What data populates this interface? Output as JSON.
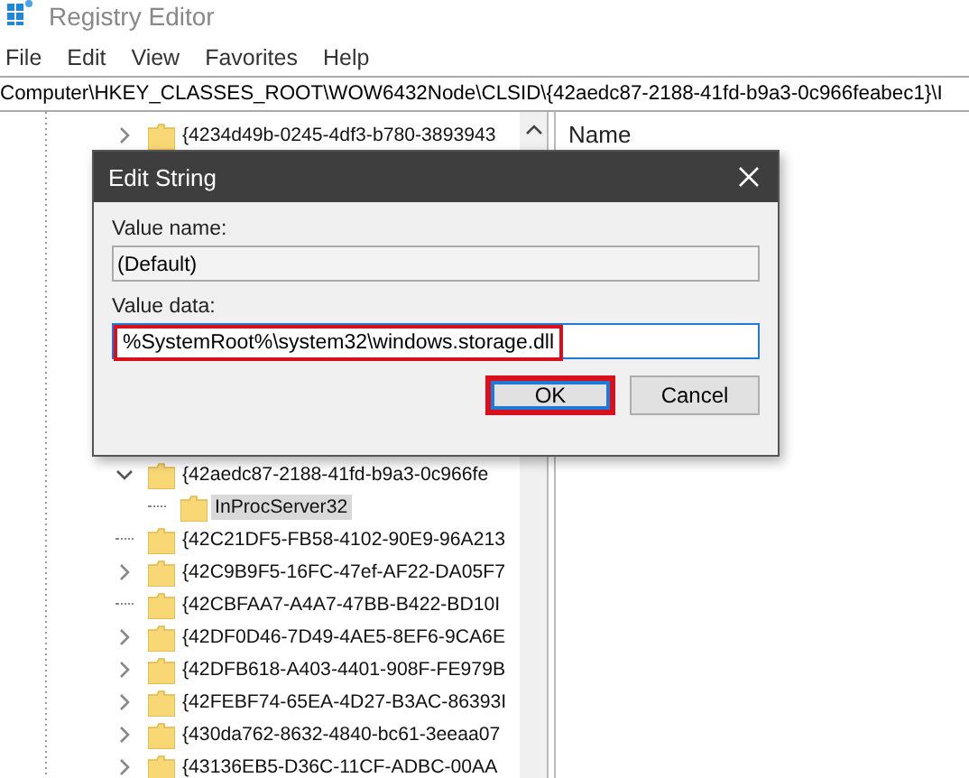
{
  "window": {
    "title": "Registry Editor"
  },
  "menu": [
    "File",
    "Edit",
    "View",
    "Favorites",
    "Help"
  ],
  "address_bar": {
    "value": "Computer\\HKEY_CLASSES_ROOT\\WOW6432Node\\CLSID\\{42aedc87-2188-41fd-b9a3-0c966feabec1}\\I"
  },
  "tree": [
    {
      "label": "{4234d49b-0245-4df3-b780-3893943",
      "kind": "collapsed",
      "selected": false
    },
    {
      "label": "{42aedc87-2188-41fd-b9a3-0c966fe",
      "kind": "expanded",
      "selected": false,
      "children": [
        {
          "label": "InProcServer32",
          "kind": "leaf",
          "selected": true
        }
      ]
    },
    {
      "label": "{42C21DF5-FB58-4102-90E9-96A213",
      "kind": "leaf",
      "selected": false
    },
    {
      "label": "{42C9B9F5-16FC-47ef-AF22-DA05F7",
      "kind": "collapsed",
      "selected": false
    },
    {
      "label": "{42CBFAA7-A4A7-47BB-B422-BD10I",
      "kind": "leaf",
      "selected": false
    },
    {
      "label": "{42DF0D46-7D49-4AE5-8EF6-9CA6E",
      "kind": "collapsed",
      "selected": false
    },
    {
      "label": "{42DFB618-A403-4401-908F-FE979B",
      "kind": "collapsed",
      "selected": false
    },
    {
      "label": "{42FEBF74-65EA-4D27-B3AC-86393I",
      "kind": "collapsed",
      "selected": false
    },
    {
      "label": "{430da762-8632-4840-bc61-3eeaa07",
      "kind": "collapsed",
      "selected": false
    },
    {
      "label": "{43136EB5-D36C-11CF-ADBC-00AA",
      "kind": "collapsed",
      "selected": false
    }
  ],
  "values_pane": {
    "columns": [
      "Name"
    ]
  },
  "dialog": {
    "title": "Edit String",
    "value_name": {
      "label": "Value name:",
      "value": "(Default)"
    },
    "value_data": {
      "label": "Value data:",
      "value": "%SystemRoot%\\system32\\windows.storage.dll",
      "highlighted": true
    },
    "buttons": [
      {
        "label": "OK",
        "default": true,
        "highlighted": true
      },
      {
        "label": "Cancel",
        "default": false,
        "highlighted": false
      }
    ]
  }
}
